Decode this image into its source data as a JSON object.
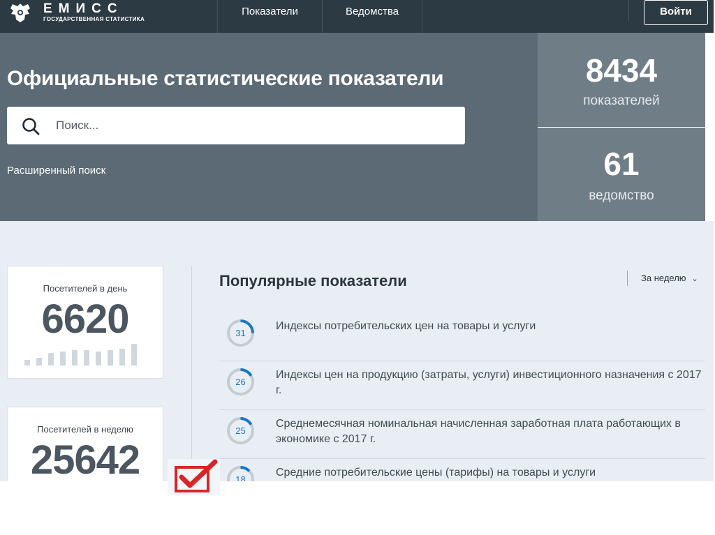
{
  "header": {
    "logo_title": "ЕМИСС",
    "logo_subtitle": "ГОСУДАРСТВЕННАЯ СТАТИСТИКА",
    "nav": [
      "Показатели",
      "Ведомства"
    ],
    "login_label": "Войти"
  },
  "hero": {
    "title": "Официальные статистические показатели",
    "search_placeholder": "Поиск...",
    "advanced_search": "Расширенный поиск"
  },
  "stats": [
    {
      "value": "8434",
      "label": "показателей"
    },
    {
      "value": "61",
      "label": "ведомство"
    }
  ],
  "visitors": [
    {
      "title": "Посетителей в день",
      "value": "6620"
    },
    {
      "title": "Посетителей в неделю",
      "value": "25642"
    }
  ],
  "popular": {
    "title": "Популярные показатели",
    "period": "За неделю",
    "items": [
      {
        "count": "31",
        "text": "Индексы потребительских цен на товары и услуги"
      },
      {
        "count": "26",
        "text": "Индексы цен на продукцию (затраты, услуги) инвестиционного назначения с 2017 г."
      },
      {
        "count": "25",
        "text": "Среднемесячная номинальная начисленная заработная плата работающих в экономике с 2017 г."
      },
      {
        "count": "18",
        "text": "Средние потребительские цены (тарифы) на товары и услуги"
      }
    ]
  },
  "colors": {
    "navbar": "#2c3a44",
    "hero": "#5b6a75",
    "stat_box": "#6f7d87",
    "accent": "#1976c8",
    "checkmark": "#d6262a"
  }
}
